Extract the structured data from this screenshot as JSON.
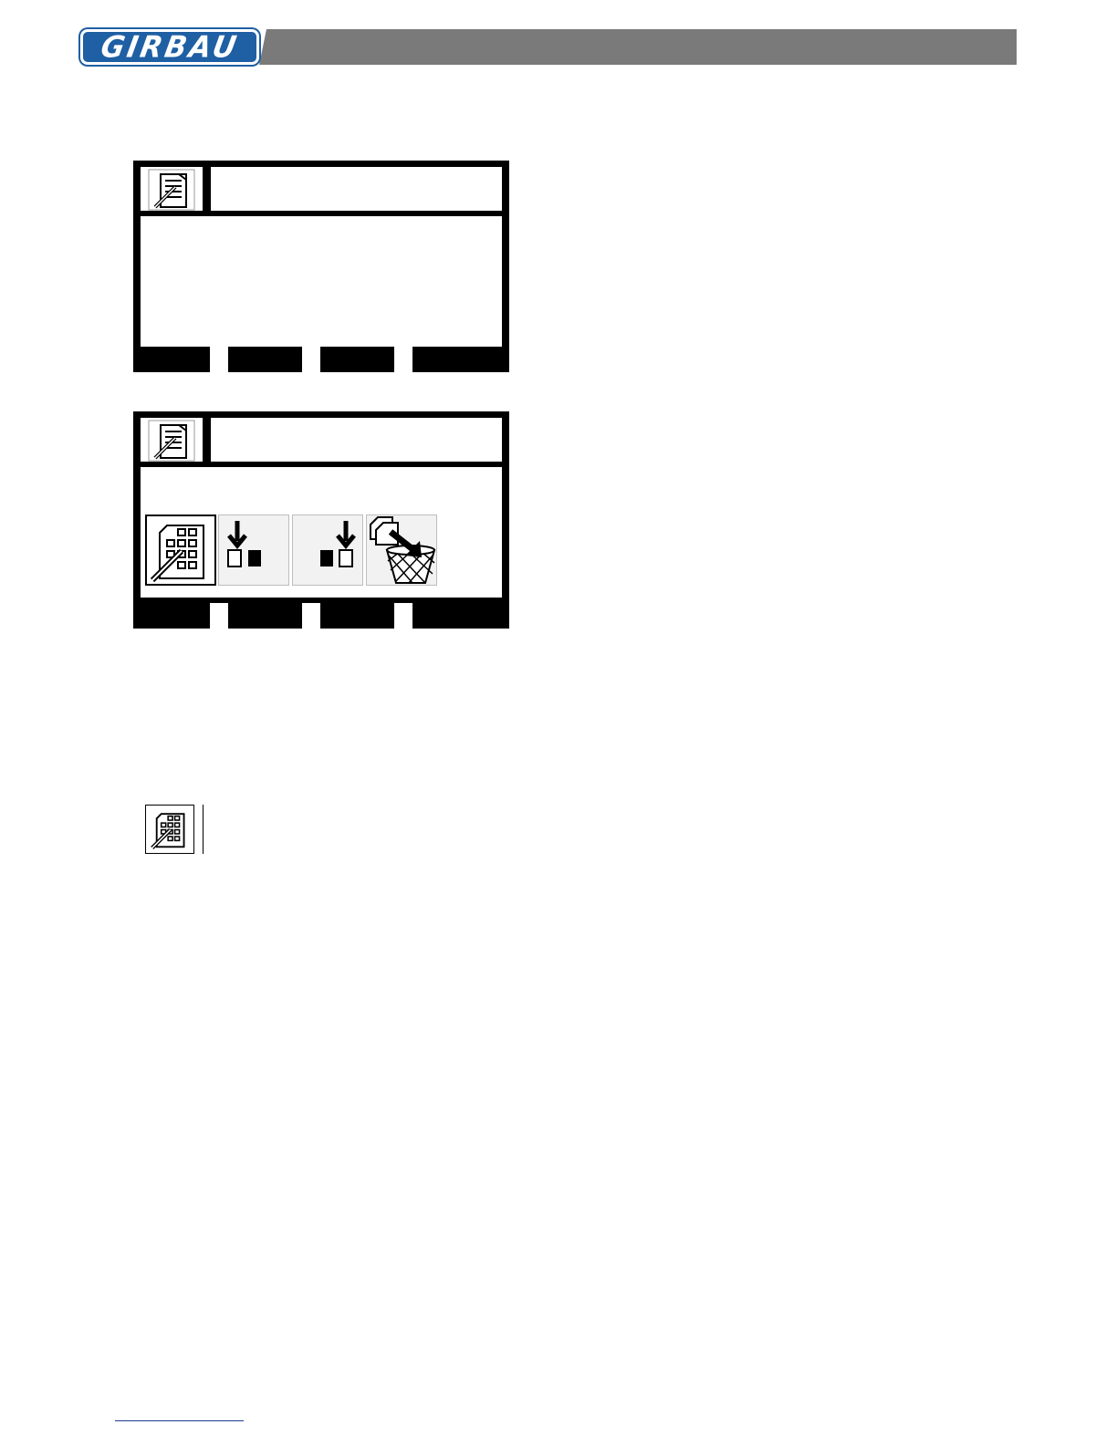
{
  "header": {
    "brand": "GIRBAU",
    "brand_color": "#1f5fa3",
    "bar_color": "#7a7a7a"
  },
  "screens": [
    {
      "icon": "document-edit-icon",
      "title": "",
      "content": "",
      "softkeys": [
        "",
        "",
        "",
        ""
      ]
    },
    {
      "icon": "document-edit-icon",
      "title": "",
      "softkeys": [
        "",
        "",
        "",
        ""
      ],
      "options": [
        {
          "icon": "keypad-edit-icon",
          "selected": true
        },
        {
          "icon": "download-left-icon",
          "selected": false
        },
        {
          "icon": "download-right-icon",
          "selected": false
        },
        {
          "icon": "delete-to-trash-icon",
          "selected": false
        }
      ]
    }
  ],
  "legend": {
    "icon": "keypad-edit-icon",
    "text": ""
  }
}
